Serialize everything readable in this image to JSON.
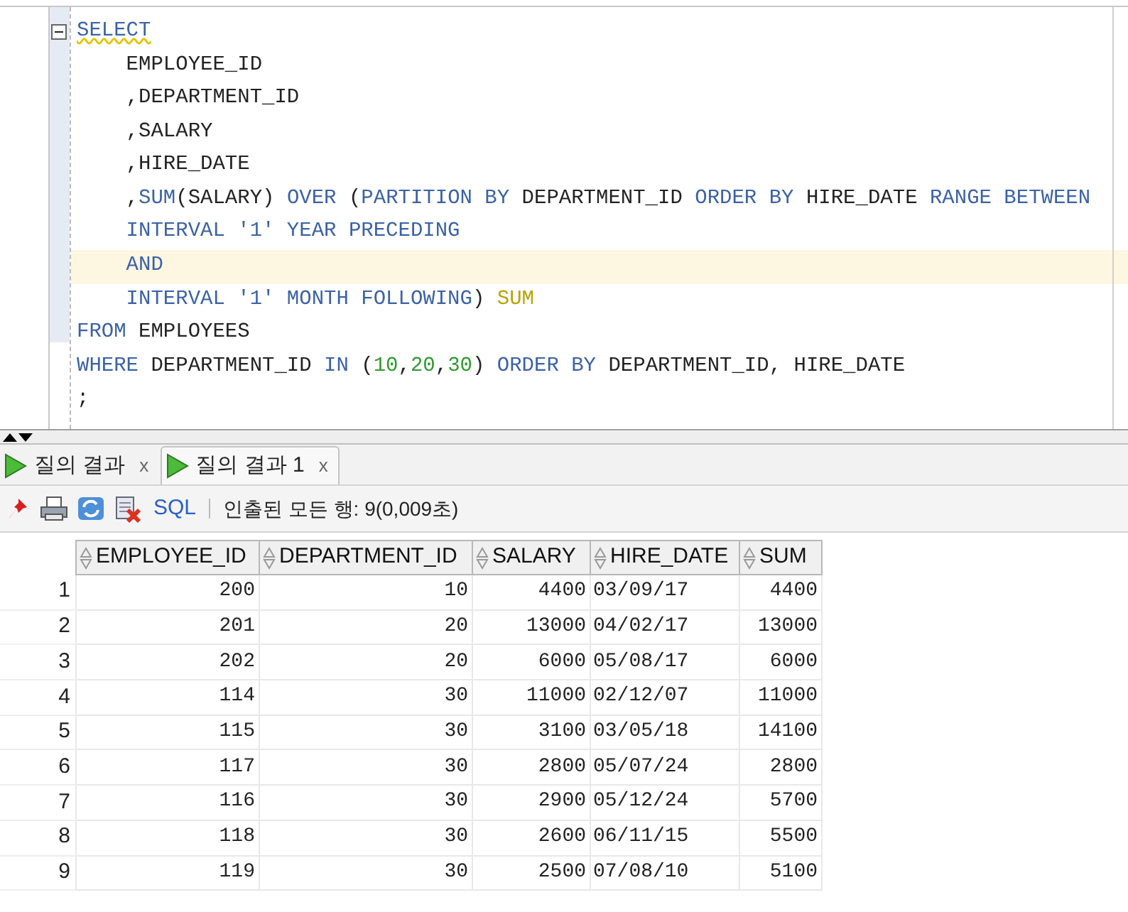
{
  "editor": {
    "lines": [
      {
        "highlighted": false,
        "fold": true,
        "tokens": [
          {
            "text": "SELECT",
            "kind": "keyword",
            "warning": true
          }
        ]
      },
      {
        "highlighted": false,
        "tokens": [
          {
            "text": "    EMPLOYEE_ID",
            "kind": "ident"
          }
        ]
      },
      {
        "highlighted": false,
        "tokens": [
          {
            "text": "    ,DEPARTMENT_ID",
            "kind": "ident"
          }
        ]
      },
      {
        "highlighted": false,
        "tokens": [
          {
            "text": "    ,SALARY",
            "kind": "ident"
          }
        ]
      },
      {
        "highlighted": false,
        "tokens": [
          {
            "text": "    ,HIRE_DATE",
            "kind": "ident"
          }
        ]
      },
      {
        "highlighted": false,
        "tokens": [
          {
            "text": "    ,",
            "kind": "ident"
          },
          {
            "text": "SUM",
            "kind": "keyword"
          },
          {
            "text": "(SALARY) ",
            "kind": "ident"
          },
          {
            "text": "OVER",
            "kind": "keyword"
          },
          {
            "text": " (",
            "kind": "ident"
          },
          {
            "text": "PARTITION BY",
            "kind": "keyword"
          },
          {
            "text": " DEPARTMENT_ID ",
            "kind": "ident"
          },
          {
            "text": "ORDER BY",
            "kind": "keyword"
          },
          {
            "text": " HIRE_DATE ",
            "kind": "ident"
          },
          {
            "text": "RANGE BETWEEN",
            "kind": "keyword"
          }
        ]
      },
      {
        "highlighted": false,
        "tokens": [
          {
            "text": "    INTERVAL ",
            "kind": "keyword"
          },
          {
            "text": "'1'",
            "kind": "string"
          },
          {
            "text": " YEAR PRECEDING",
            "kind": "keyword"
          }
        ]
      },
      {
        "highlighted": true,
        "tokens": [
          {
            "text": "    AND",
            "kind": "keyword"
          }
        ]
      },
      {
        "highlighted": false,
        "tokens": [
          {
            "text": "    INTERVAL ",
            "kind": "keyword"
          },
          {
            "text": "'1'",
            "kind": "string"
          },
          {
            "text": " MONTH FOLLOWING",
            "kind": "keyword"
          },
          {
            "text": ") ",
            "kind": "ident"
          },
          {
            "text": "SUM",
            "kind": "alias"
          }
        ]
      },
      {
        "highlighted": false,
        "tokens": [
          {
            "text": "FROM",
            "kind": "keyword"
          },
          {
            "text": " EMPLOYEES",
            "kind": "ident"
          }
        ]
      },
      {
        "highlighted": false,
        "tokens": [
          {
            "text": "WHERE",
            "kind": "keyword"
          },
          {
            "text": " DEPARTMENT_ID ",
            "kind": "ident"
          },
          {
            "text": "IN",
            "kind": "keyword"
          },
          {
            "text": " (",
            "kind": "ident"
          },
          {
            "text": "10",
            "kind": "number"
          },
          {
            "text": ",",
            "kind": "ident"
          },
          {
            "text": "20",
            "kind": "number"
          },
          {
            "text": ",",
            "kind": "ident"
          },
          {
            "text": "30",
            "kind": "number"
          },
          {
            "text": ") ",
            "kind": "ident"
          },
          {
            "text": "ORDER BY",
            "kind": "keyword"
          },
          {
            "text": " DEPARTMENT_ID, HIRE_DATE",
            "kind": "ident"
          }
        ]
      },
      {
        "highlighted": false,
        "tokens": [
          {
            "text": ";",
            "kind": "ident"
          }
        ]
      }
    ]
  },
  "tabs": [
    {
      "label": "질의 결과",
      "close": "x",
      "selected": false
    },
    {
      "label": "질의 결과 1",
      "close": "x",
      "selected": true
    }
  ],
  "toolbar": {
    "sql_link": "SQL",
    "status": "인출된 모든 행: 9(0,009초)"
  },
  "table": {
    "columns": [
      "EMPLOYEE_ID",
      "DEPARTMENT_ID",
      "SALARY",
      "HIRE_DATE",
      "SUM"
    ],
    "rows": [
      {
        "number": "1",
        "cells": [
          "200",
          "10",
          "4400",
          "03/09/17",
          "4400"
        ]
      },
      {
        "number": "2",
        "cells": [
          "201",
          "20",
          "13000",
          "04/02/17",
          "13000"
        ]
      },
      {
        "number": "3",
        "cells": [
          "202",
          "20",
          "6000",
          "05/08/17",
          "6000"
        ]
      },
      {
        "number": "4",
        "cells": [
          "114",
          "30",
          "11000",
          "02/12/07",
          "11000"
        ]
      },
      {
        "number": "5",
        "cells": [
          "115",
          "30",
          "3100",
          "03/05/18",
          "14100"
        ]
      },
      {
        "number": "6",
        "cells": [
          "117",
          "30",
          "2800",
          "05/07/24",
          "2800"
        ]
      },
      {
        "number": "7",
        "cells": [
          "116",
          "30",
          "2900",
          "05/12/24",
          "5700"
        ]
      },
      {
        "number": "8",
        "cells": [
          "118",
          "30",
          "2600",
          "06/11/15",
          "5500"
        ]
      },
      {
        "number": "9",
        "cells": [
          "119",
          "30",
          "2500",
          "07/08/10",
          "5100"
        ]
      }
    ]
  }
}
